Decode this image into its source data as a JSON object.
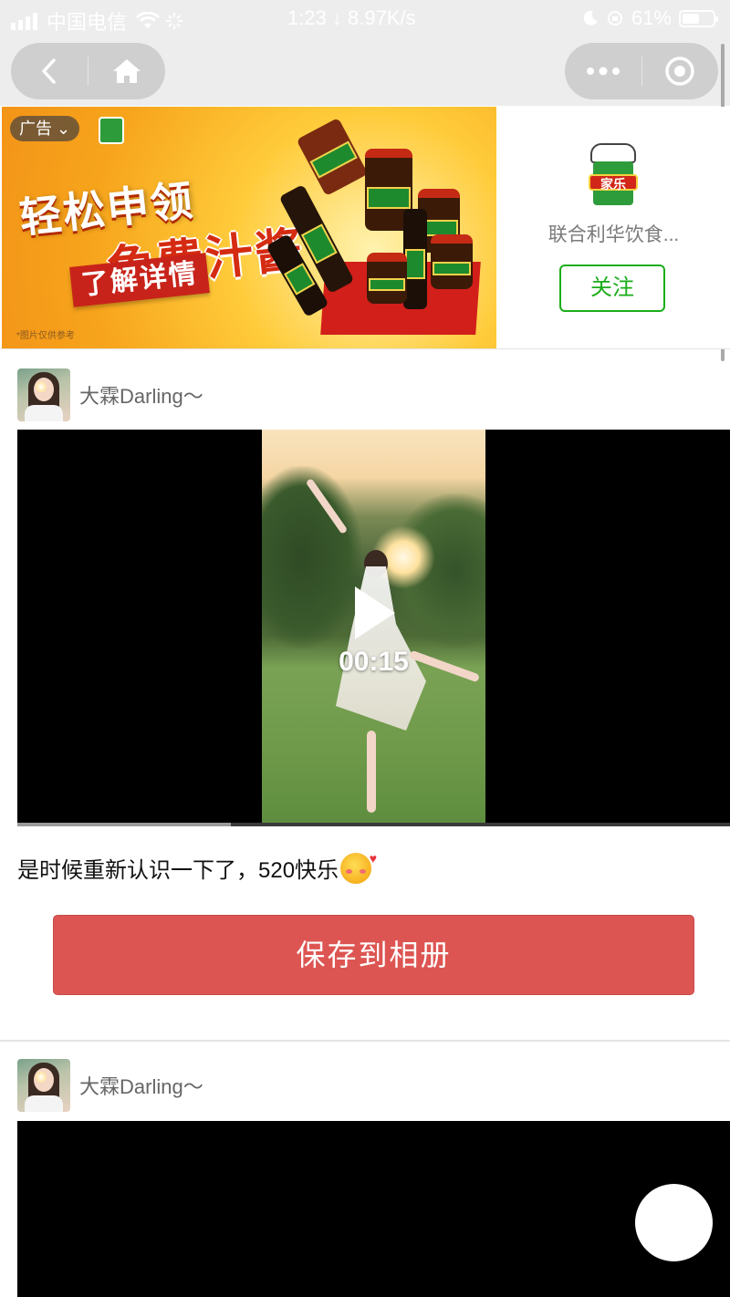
{
  "status_bar": {
    "carrier": "中国电信",
    "time_speed": "1:23 ↓ 8.97K/s",
    "battery": "61%",
    "battery_level": 0.61
  },
  "nav": {
    "back_icon": "back-chevron-icon",
    "home_icon": "home-icon",
    "more_icon": "more-dots-icon",
    "close_icon": "target-circle-icon"
  },
  "ad": {
    "tag": "广告",
    "headline_line1": "轻松申领",
    "headline_line2": "免费汁酱",
    "cta": "了解详情",
    "note": "*图片仅供参考",
    "brand_logo_text": "家乐",
    "advertiser_name": "联合利华饮食...",
    "follow_label": "关注",
    "colors": {
      "follow_green": "#1aad19",
      "banner_orange": "#f7a51c"
    }
  },
  "posts": [
    {
      "username": "大霖Darling～",
      "video_duration": "00:15",
      "progress": 0.3,
      "caption": "是时候重新认识一下了，520快乐"
    },
    {
      "username": "大霖Darling～"
    }
  ],
  "save_button": {
    "label": "保存到相册",
    "color": "#dd5552"
  }
}
